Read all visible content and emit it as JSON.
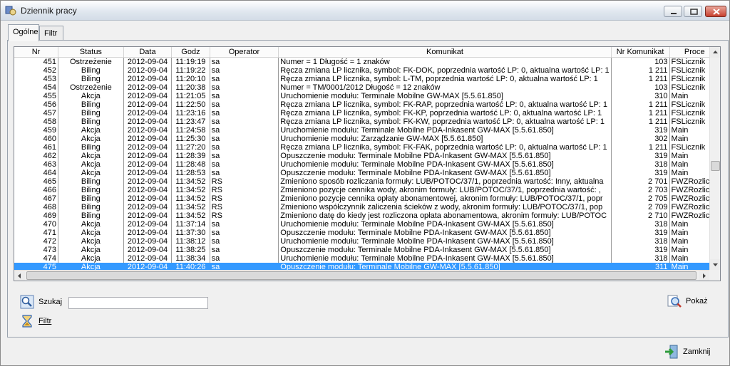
{
  "window": {
    "title": "Dziennik pracy"
  },
  "tabs": [
    {
      "label": "Ogólne",
      "active": true
    },
    {
      "label": "Filtr",
      "active": false
    }
  ],
  "table": {
    "columns": [
      "Nr",
      "Status",
      "Data",
      "Godz",
      "Operator",
      "Komunikat",
      "Nr Komunikat",
      "Proce"
    ],
    "rows": [
      [
        "451",
        "Ostrzeżenie",
        "2012-09-04",
        "11:19:19",
        "sa",
        "Numer = 1 Długość = 1 znaków",
        "103",
        "FSLicznik"
      ],
      [
        "452",
        "Biling",
        "2012-09-04",
        "11:19:22",
        "sa",
        "Ręcza zmiana LP licznika, symbol: FK-DOK, poprzednia wartość LP: 0, aktualna wartość LP: 1",
        "1 211",
        "FSLicznik"
      ],
      [
        "453",
        "Biling",
        "2012-09-04",
        "11:20:10",
        "sa",
        "Ręcza zmiana LP licznika, symbol: L-TM, poprzednia wartość LP: 0, aktualna wartość LP: 1",
        "1 211",
        "FSLicznik"
      ],
      [
        "454",
        "Ostrzeżenie",
        "2012-09-04",
        "11:20:38",
        "sa",
        "Numer = TM/0001/2012 Długość = 12 znaków",
        "103",
        "FSLicznik"
      ],
      [
        "455",
        "Akcja",
        "2012-09-04",
        "11:21:05",
        "sa",
        "Uruchomienie modułu: Terminale Mobilne GW-MAX [5.5.61.850]",
        "310",
        "Main"
      ],
      [
        "456",
        "Biling",
        "2012-09-04",
        "11:22:50",
        "sa",
        "Ręcza zmiana LP licznika, symbol: FK-RAP, poprzednia wartość LP: 0, aktualna wartość LP: 1",
        "1 211",
        "FSLicznik"
      ],
      [
        "457",
        "Biling",
        "2012-09-04",
        "11:23:16",
        "sa",
        "Ręcza zmiana LP licznika, symbol: FK-KP, poprzednia wartość LP: 0, aktualna wartość LP: 1",
        "1 211",
        "FSLicznik"
      ],
      [
        "458",
        "Biling",
        "2012-09-04",
        "11:23:47",
        "sa",
        "Ręcza zmiana LP licznika, symbol: FK-KW, poprzednia wartość LP: 0, aktualna wartość LP: 1",
        "1 211",
        "FSLicznik"
      ],
      [
        "459",
        "Akcja",
        "2012-09-04",
        "11:24:58",
        "sa",
        "Uruchomienie modułu: Terminale Mobilne PDA-Inkasent GW-MAX [5.5.61.850]",
        "319",
        "Main"
      ],
      [
        "460",
        "Akcja",
        "2012-09-04",
        "11:25:30",
        "sa",
        "Uruchomienie modułu: Zarządzanie GW-MAX [5.5.61.850]",
        "302",
        "Main"
      ],
      [
        "461",
        "Biling",
        "2012-09-04",
        "11:27:20",
        "sa",
        "Ręcza zmiana LP licznika, symbol: FK-FAK, poprzednia wartość LP: 0, aktualna wartość LP: 1",
        "1 211",
        "FSLicznik"
      ],
      [
        "462",
        "Akcja",
        "2012-09-04",
        "11:28:39",
        "sa",
        "Opuszczenie modułu: Terminale Mobilne PDA-Inkasent GW-MAX [5.5.61.850]",
        "319",
        "Main"
      ],
      [
        "463",
        "Akcja",
        "2012-09-04",
        "11:28:48",
        "sa",
        "Uruchomienie modułu: Terminale Mobilne PDA-Inkasent GW-MAX [5.5.61.850]",
        "318",
        "Main"
      ],
      [
        "464",
        "Akcja",
        "2012-09-04",
        "11:28:53",
        "sa",
        "Opuszczenie modułu: Terminale Mobilne PDA-Inkasent GW-MAX [5.5.61.850]",
        "319",
        "Main"
      ],
      [
        "465",
        "Biling",
        "2012-09-04",
        "11:34:52",
        "RS",
        "Zmieniono sposób rozliczania formuły: LUB/POTOC/37/1, poprzednia wartość: Inny, aktualna",
        "2 701",
        "FWZRozlicze"
      ],
      [
        "466",
        "Biling",
        "2012-09-04",
        "11:34:52",
        "RS",
        "Zmieniono pozycje cennika wody, akronim formuły: LUB/POTOC/37/1, poprzednia wartość: ,",
        "2 703",
        "FWZRozlicze"
      ],
      [
        "467",
        "Biling",
        "2012-09-04",
        "11:34:52",
        "RS",
        "Zmieniono pozycje cennika opłaty abonamentowej, akronim formuły: LUB/POTOC/37/1, popr",
        "2 705",
        "FWZRozlicze"
      ],
      [
        "468",
        "Biling",
        "2012-09-04",
        "11:34:52",
        "RS",
        "Zmieniono współczynnik zaliczenia ścieków z wody, akronim formuły: LUB/POTOC/37/1, pop",
        "2 709",
        "FWZRozlicze"
      ],
      [
        "469",
        "Biling",
        "2012-09-04",
        "11:34:52",
        "RS",
        "Zmieniono datę do kiedy jest rozliczona opłata abonamentowa, akronim formuły: LUB/POTOC",
        "2 710",
        "FWZRozlicze"
      ],
      [
        "470",
        "Akcja",
        "2012-09-04",
        "11:37:14",
        "sa",
        "Uruchomienie modułu: Terminale Mobilne PDA-Inkasent GW-MAX [5.5.61.850]",
        "318",
        "Main"
      ],
      [
        "471",
        "Akcja",
        "2012-09-04",
        "11:37:30",
        "sa",
        "Opuszczenie modułu: Terminale Mobilne PDA-Inkasent GW-MAX [5.5.61.850]",
        "319",
        "Main"
      ],
      [
        "472",
        "Akcja",
        "2012-09-04",
        "11:38:12",
        "sa",
        "Uruchomienie modułu: Terminale Mobilne PDA-Inkasent GW-MAX [5.5.61.850]",
        "318",
        "Main"
      ],
      [
        "473",
        "Akcja",
        "2012-09-04",
        "11:38:25",
        "sa",
        "Opuszczenie modułu: Terminale Mobilne PDA-Inkasent GW-MAX [5.5.61.850]",
        "319",
        "Main"
      ],
      [
        "474",
        "Akcja",
        "2012-09-04",
        "11:38:34",
        "sa",
        "Uruchomienie modułu: Terminale Mobilne PDA-Inkasent GW-MAX [5.5.61.850]",
        "318",
        "Main"
      ],
      [
        "475",
        "Akcja",
        "2012-09-04",
        "11:40:26",
        "sa",
        "Opuszczenie modułu: Terminale Mobilne GW-MAX [5.5.61.850]",
        "311",
        "Main"
      ]
    ],
    "selected_row": 24
  },
  "search": {
    "label": "Szukaj",
    "value": ""
  },
  "filter_button": {
    "label": "Filtr"
  },
  "show_button": {
    "label": "Pokaż"
  },
  "close_button": {
    "label": "Zamknij"
  },
  "icons": {
    "app": "app-icon",
    "search": "magnifier-icon",
    "filter": "hourglass-icon",
    "show": "magnifier-sheet-icon",
    "close": "exit-door-icon"
  }
}
